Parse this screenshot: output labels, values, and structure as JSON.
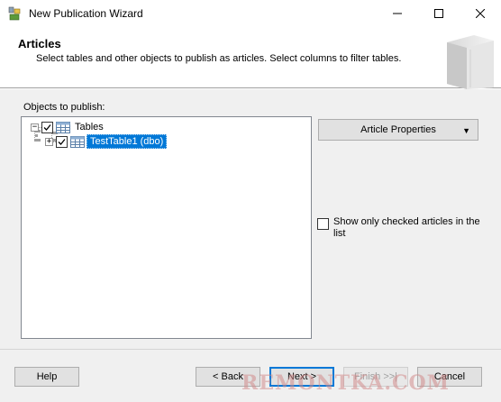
{
  "window": {
    "title": "New Publication Wizard",
    "app_icon": "publication-wizard-icon",
    "minimize_icon": "minimize-icon",
    "maximize_icon": "maximize-icon",
    "close_icon": "close-icon"
  },
  "header": {
    "title": "Articles",
    "subtitle": "Select tables and other objects to publish as articles. Select columns to filter tables."
  },
  "objects": {
    "label": "Objects to publish:",
    "tree": [
      {
        "label": "Tables",
        "checked": true,
        "expanded": true,
        "icon": "table-icon"
      },
      {
        "label": "TestTable1 (dbo)",
        "checked": true,
        "expanded": false,
        "selected": true,
        "icon": "table-icon"
      }
    ]
  },
  "article_properties": {
    "label": "Article Properties",
    "arrow": "▼"
  },
  "show_only_checked": {
    "label": "Show only checked articles in the list",
    "checked": false
  },
  "footer": {
    "help": "Help",
    "back": "< Back",
    "next": "Next >",
    "finish": "Finish >>|",
    "cancel": "Cancel"
  },
  "watermark": "REMONTKA.COM",
  "colors": {
    "selection": "#0078d7",
    "panel": "#f0f0f0",
    "button": "#e1e1e1"
  }
}
